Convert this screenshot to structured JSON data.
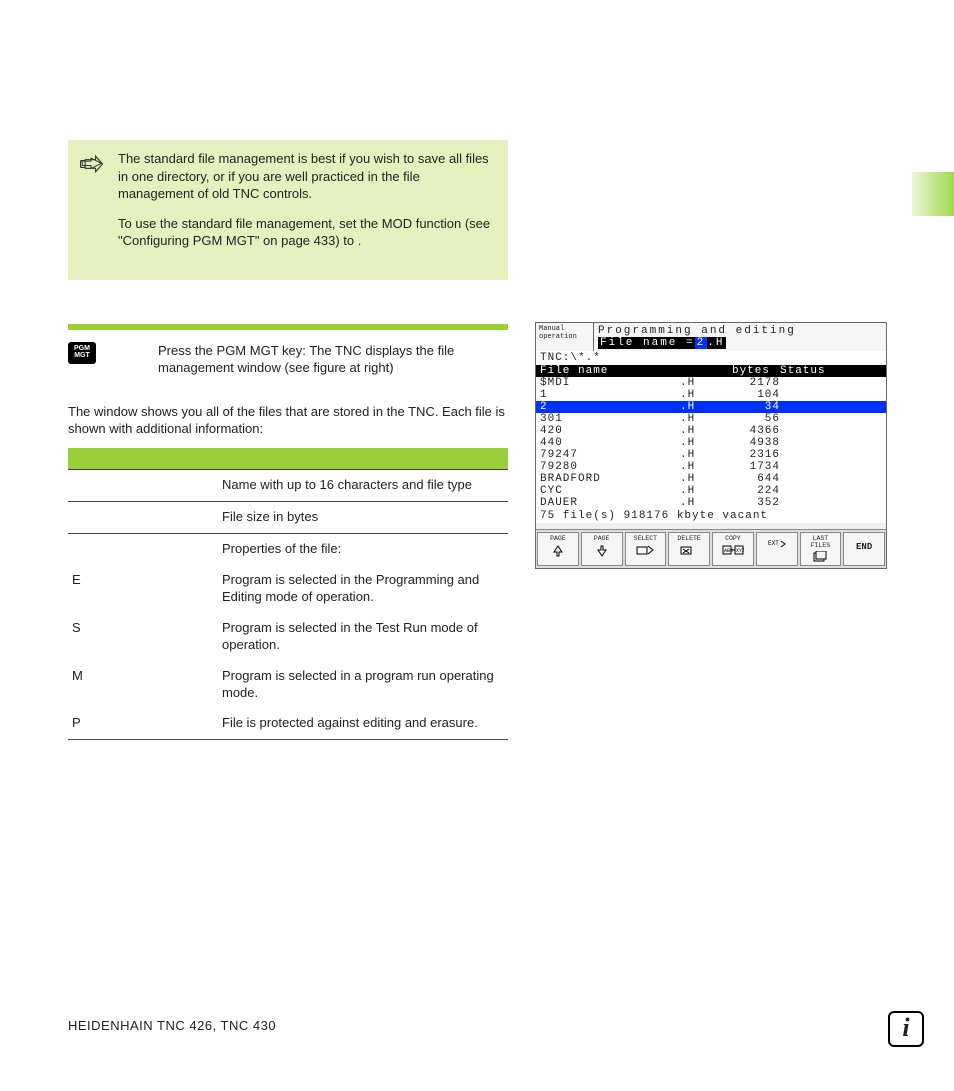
{
  "tip": {
    "p1": "The standard file management is best if you wish to save all files in one directory, or if you are well practiced in the file management of old TNC controls.",
    "p2": "To use the standard file management, set the MOD function               (see \"Configuring PGM MGT\" on page 433) to                 ."
  },
  "key_instruction": "Press the PGM MGT key: The TNC displays the file management window (see figure at right)",
  "pgm_key_l1": "PGM",
  "pgm_key_l2": "MGT",
  "intro": "The window shows you all of the files that are stored in the TNC. Each file is shown with additional information:",
  "table": {
    "rows": [
      {
        "c1": "",
        "c2": "Name with up to 16 characters and file type"
      },
      {
        "c1": "",
        "c2": "File size in bytes"
      },
      {
        "c1": "",
        "c2": "Properties of the file:"
      },
      {
        "c1": "E",
        "c2": "Program is selected in the Programming and Editing mode of operation."
      },
      {
        "c1": "S",
        "c2": "Program is selected in the Test Run mode of operation."
      },
      {
        "c1": "M",
        "c2": "Program is selected in a program run operating mode."
      },
      {
        "c1": "P",
        "c2": "File is protected against editing and erasure."
      }
    ]
  },
  "screenshot": {
    "mode_l1": "Manual",
    "mode_l2": "operation",
    "title": "Programming and editing",
    "filename_prompt": "File name =",
    "filename_cursor": "2",
    "filename_ext": ".H",
    "path": "TNC:\\*.*",
    "header": {
      "name": "File name",
      "bytes": "bytes",
      "status": "Status"
    },
    "files": [
      {
        "name": "$MDI",
        "ext": ".H",
        "bytes": "2178",
        "sel": false
      },
      {
        "name": "1",
        "ext": ".H",
        "bytes": "104",
        "sel": false
      },
      {
        "name": "2",
        "ext": ".H",
        "bytes": "34",
        "sel": true
      },
      {
        "name": "301",
        "ext": ".H",
        "bytes": "56",
        "sel": false
      },
      {
        "name": "420",
        "ext": ".H",
        "bytes": "4366",
        "sel": false
      },
      {
        "name": "440",
        "ext": ".H",
        "bytes": "4938",
        "sel": false
      },
      {
        "name": "79247",
        "ext": ".H",
        "bytes": "2316",
        "sel": false
      },
      {
        "name": "79280",
        "ext": ".H",
        "bytes": "1734",
        "sel": false
      },
      {
        "name": "BRADFORD",
        "ext": ".H",
        "bytes": "644",
        "sel": false
      },
      {
        "name": "CYC",
        "ext": ".H",
        "bytes": "224",
        "sel": false
      },
      {
        "name": "DAUER",
        "ext": ".H",
        "bytes": "352",
        "sel": false
      }
    ],
    "status_line": "75  file(s) 918176 kbyte vacant",
    "softkeys": [
      {
        "label": "PAGE",
        "icon": "up-arrow"
      },
      {
        "label": "PAGE",
        "icon": "down-arrow"
      },
      {
        "label": "SELECT",
        "icon": "select"
      },
      {
        "label": "DELETE",
        "icon": "delete"
      },
      {
        "label": "COPY",
        "icon": "copy"
      },
      {
        "label": "",
        "icon": "ext"
      },
      {
        "label": "LAST FILES",
        "icon": "file"
      },
      {
        "label": "END",
        "icon": ""
      }
    ]
  },
  "footer": "HEIDENHAIN TNC 426, TNC 430",
  "info_glyph": "i"
}
